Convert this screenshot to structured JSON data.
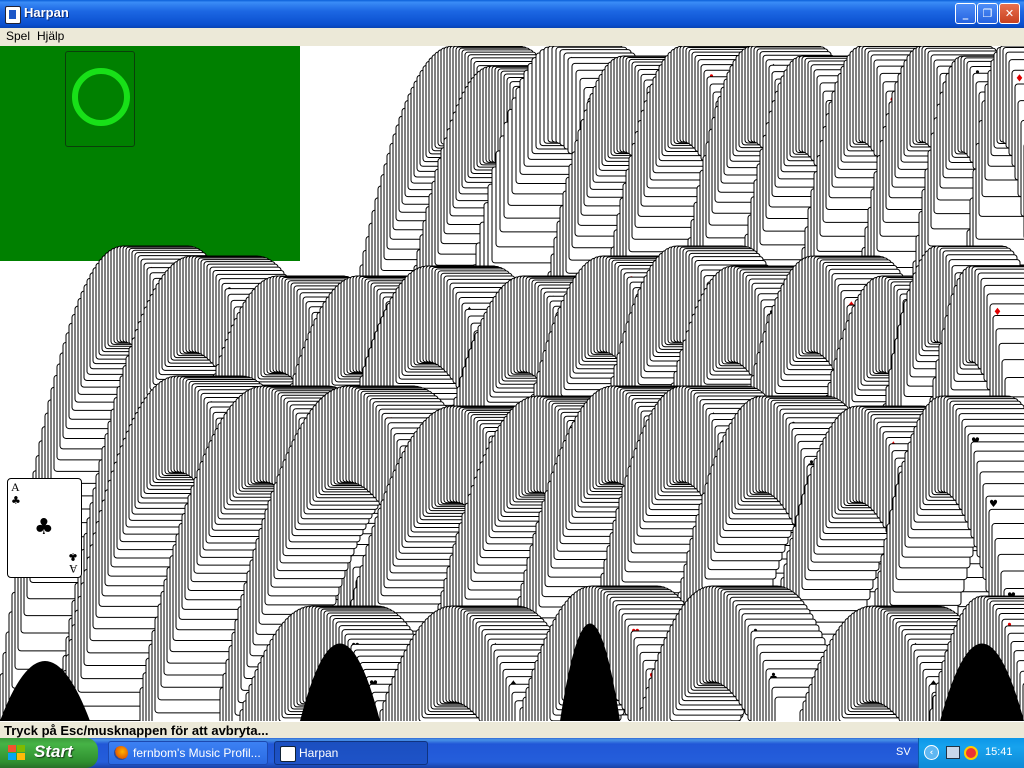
{
  "window": {
    "title": "Harpan",
    "minimize_glyph": "_",
    "maximize_glyph": "❐",
    "close_glyph": "✕"
  },
  "menu": {
    "items": [
      "Spel",
      "Hjälp"
    ]
  },
  "game": {
    "felt_color": "#008000",
    "deck_ring_color": "#18e018",
    "front_card": {
      "rank": "A",
      "suit": "♣",
      "suit_name": "clubs"
    },
    "status_text": "Tryck på Esc/musknappen för att avbryta..."
  },
  "taskbar": {
    "start_label": "Start",
    "tasks": [
      {
        "label": "fernbom's Music Profil...",
        "icon": "firefox-icon",
        "active": false
      },
      {
        "label": "Harpan",
        "icon": "harpan-icon",
        "active": true
      }
    ],
    "language": "SV",
    "tray_icons": [
      "chevron-left-icon",
      "network-icon",
      "security-shield-icon"
    ],
    "clock": "15:41"
  }
}
